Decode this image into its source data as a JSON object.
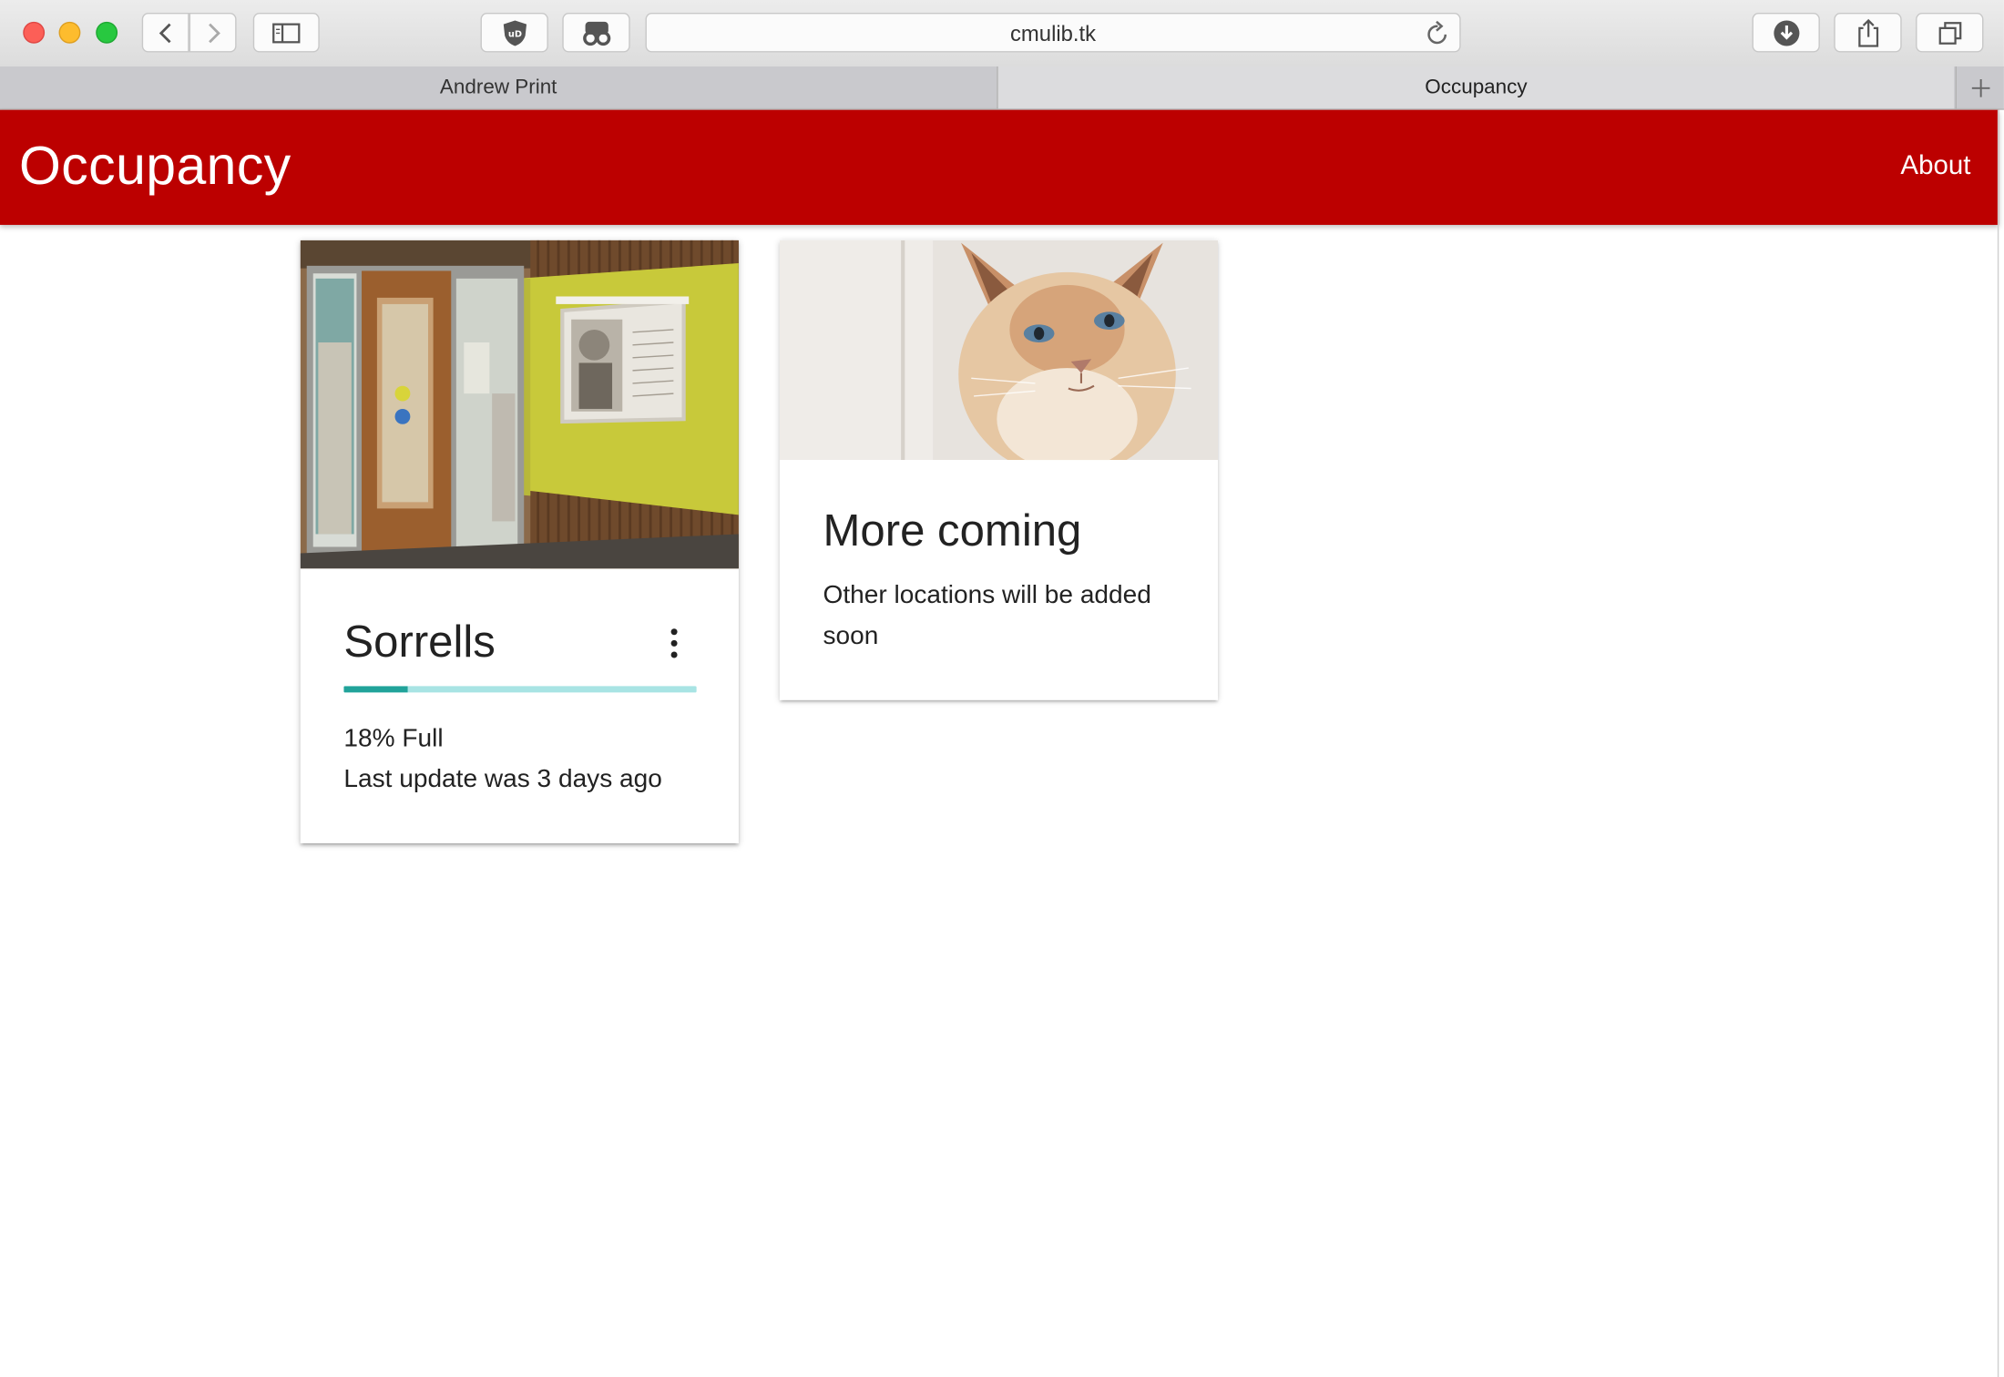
{
  "browser": {
    "url": "cmulib.tk",
    "tabs": [
      {
        "label": "Andrew Print",
        "active": false
      },
      {
        "label": "Occupancy",
        "active": true
      }
    ]
  },
  "appbar": {
    "title": "Occupancy",
    "about_label": "About",
    "color": "#bc0000"
  },
  "cards": [
    {
      "title": "Sorrells",
      "image": "library-entrance-photo",
      "occupancy_fraction": 0.18,
      "status": "18% Full",
      "last_update": "Last update was 3 days ago",
      "progress_colors": {
        "fill": "#21a39a",
        "track": "#a8e4e4"
      }
    },
    {
      "title": "More coming",
      "image": "cat-photo",
      "description": "Other locations will be added soon"
    }
  ],
  "icons": [
    "back-icon",
    "forward-icon",
    "sidebar-icon",
    "ublock-shield-icon",
    "reader-glasses-icon",
    "reload-icon",
    "download-icon",
    "share-icon",
    "tabs-overview-icon",
    "new-tab-plus-icon",
    "more-vert-icon"
  ]
}
